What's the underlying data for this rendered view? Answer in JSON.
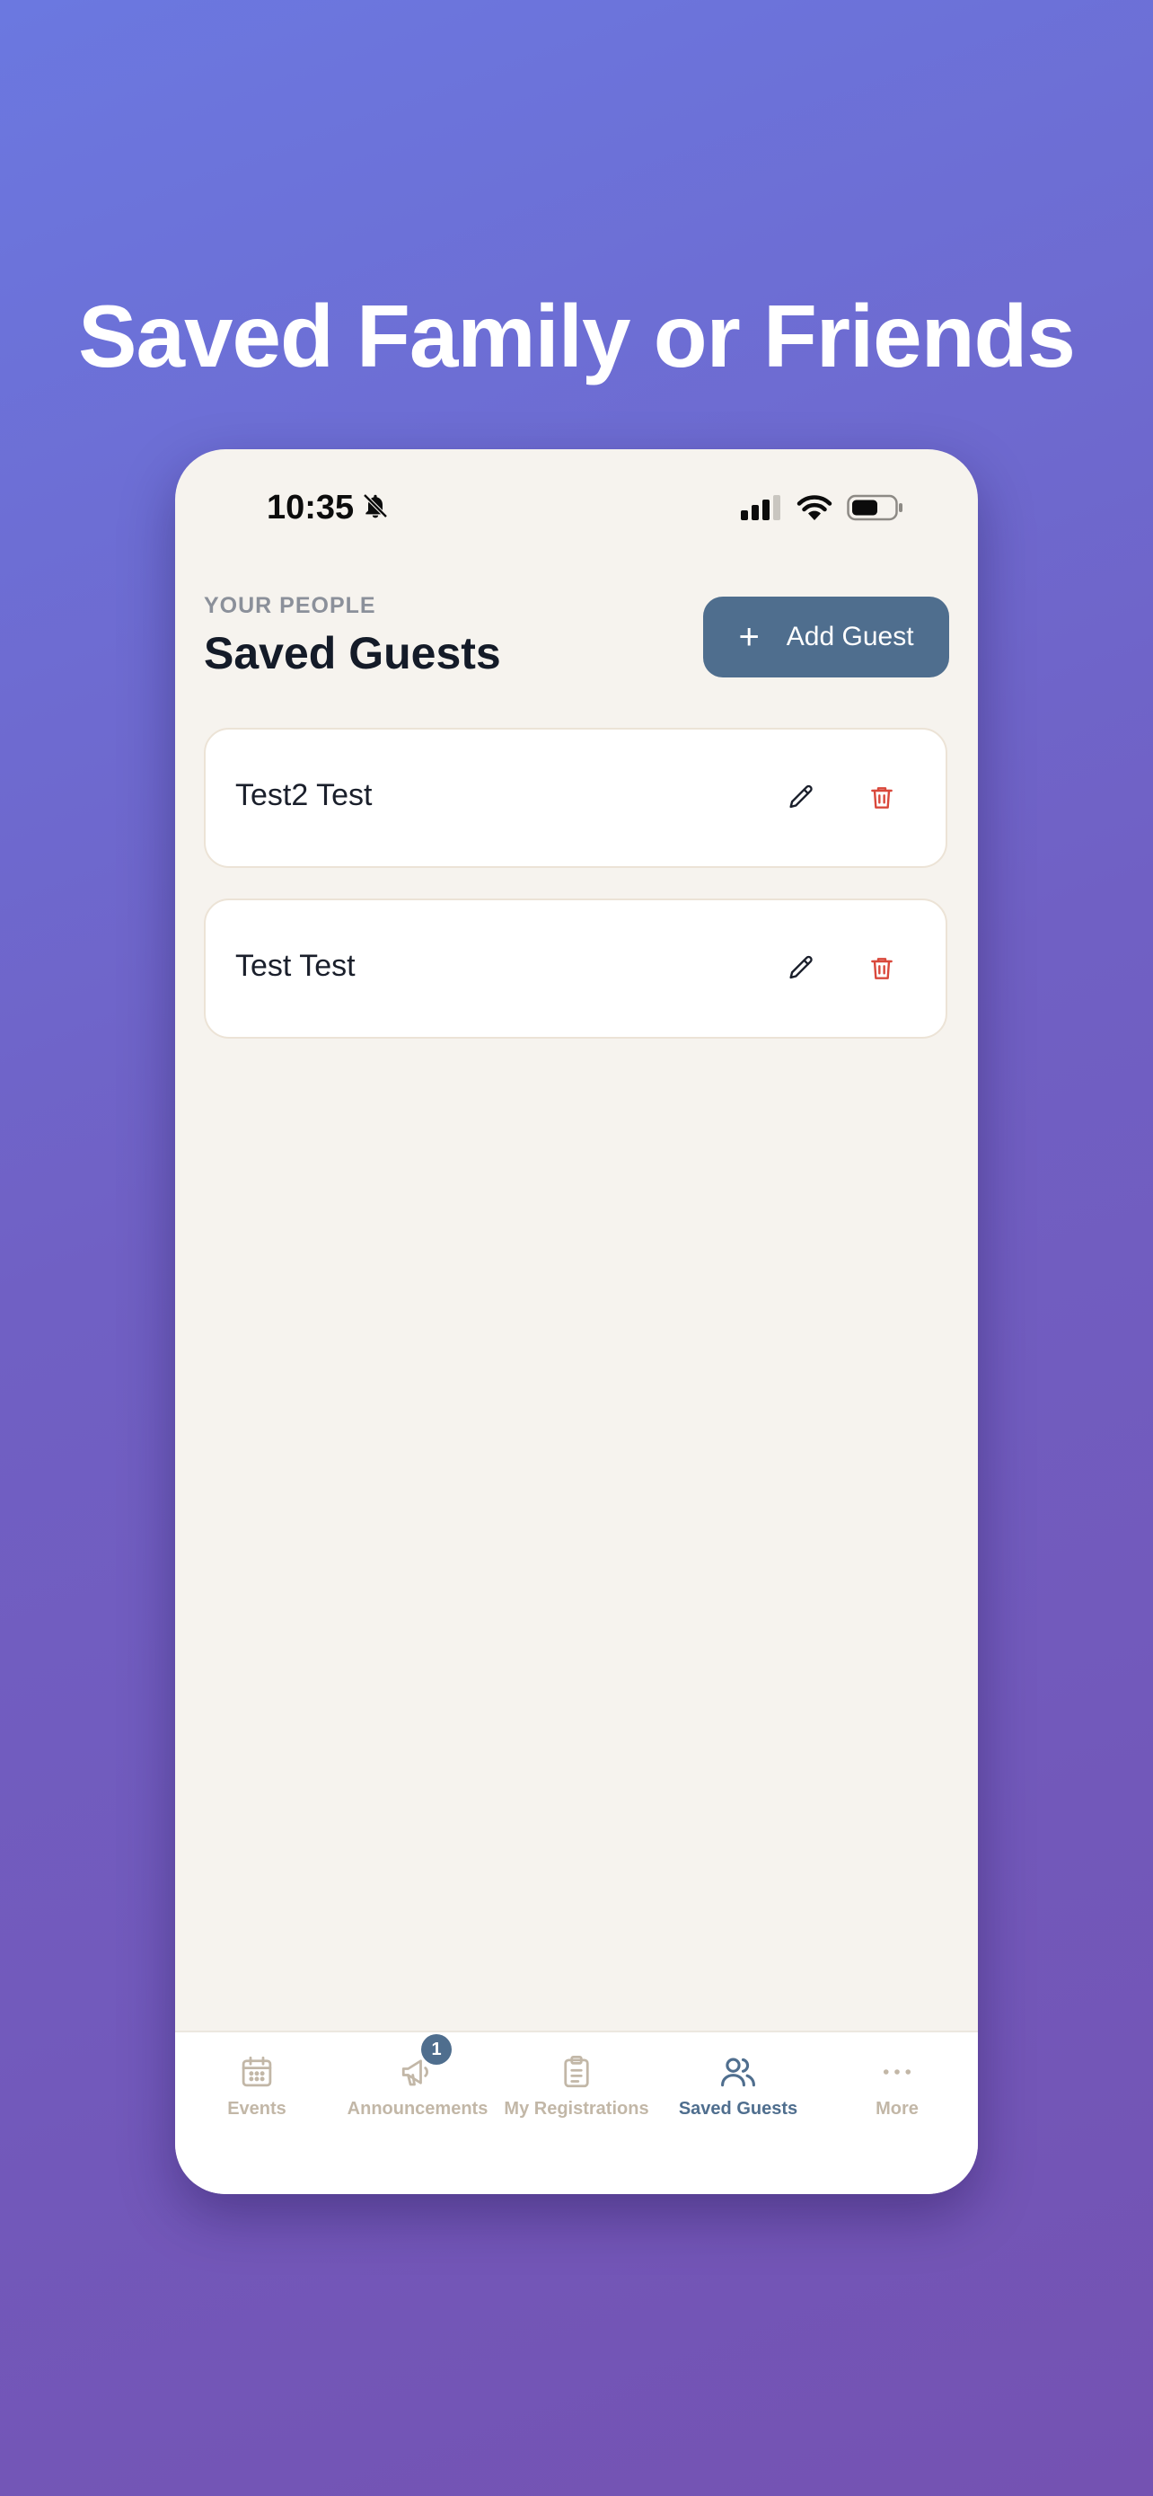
{
  "hero": {
    "title": "Saved Family or Friends"
  },
  "status_bar": {
    "time": "10:35",
    "icons": [
      "bell-slash-icon",
      "cellular-signal-icon",
      "wifi-icon",
      "battery-icon"
    ]
  },
  "header": {
    "eyebrow": "YOUR PEOPLE",
    "title": "Saved Guests",
    "add_button_label": "Add Guest",
    "add_button_icon": "plus-icon"
  },
  "guests": [
    {
      "name": "Test2 Test"
    },
    {
      "name": "Test Test"
    }
  ],
  "guest_actions": {
    "edit_icon": "pencil-icon",
    "delete_icon": "trash-icon"
  },
  "tab_bar": {
    "items": [
      {
        "label": "Events",
        "icon": "calendar-icon",
        "active": false
      },
      {
        "label": "Announcements",
        "icon": "megaphone-icon",
        "active": false,
        "badge": "1"
      },
      {
        "label": "My Registrations",
        "icon": "clipboard-icon",
        "active": false
      },
      {
        "label": "Saved Guests",
        "icon": "users-icon",
        "active": true
      },
      {
        "label": "More",
        "icon": "more-dots-icon",
        "active": false
      }
    ]
  },
  "colors": {
    "accent": "#4f6e8e",
    "delete": "#d9483b",
    "inactive_tab": "#c2b7a7",
    "screen_background": "#f6f3ee"
  }
}
